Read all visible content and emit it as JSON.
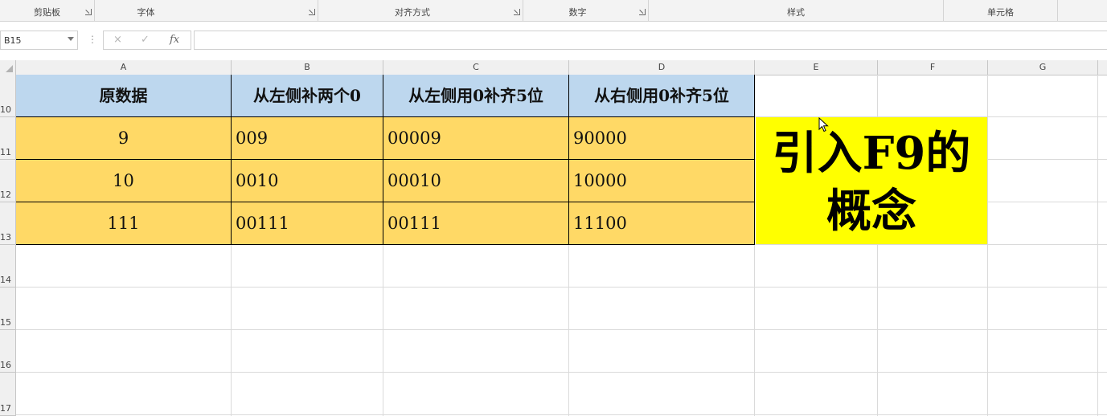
{
  "ribbon": {
    "groups": [
      {
        "label": "剪贴板"
      },
      {
        "label": "字体"
      },
      {
        "label": "对齐方式"
      },
      {
        "label": "数字"
      },
      {
        "label": "样式"
      },
      {
        "label": "单元格"
      }
    ]
  },
  "formula_bar": {
    "name_box": "B15",
    "cancel_icon": "×",
    "enter_icon": "✓",
    "fx_label": "fx",
    "formula": ""
  },
  "columns": [
    "A",
    "B",
    "C",
    "D",
    "E",
    "F",
    "G"
  ],
  "rows": [
    "10",
    "11",
    "12",
    "13",
    "14",
    "15",
    "16",
    "17"
  ],
  "table": {
    "headers": [
      "原数据",
      "从左侧补两个0",
      "从左侧用0补齐5位",
      "从右侧用0补齐5位"
    ],
    "rows": [
      [
        "9",
        "009",
        "00009",
        "90000"
      ],
      [
        "10",
        "0010",
        "00010",
        "10000"
      ],
      [
        "111",
        "00111",
        "00111",
        "11100"
      ]
    ]
  },
  "callout": {
    "line1": "引入F9的",
    "line2": "概念"
  },
  "colors": {
    "header_fill": "#bdd7ee",
    "data_fill": "#ffd966",
    "callout_fill": "#ffff00"
  },
  "icons": {
    "cursor": "mouse-pointer-icon"
  }
}
